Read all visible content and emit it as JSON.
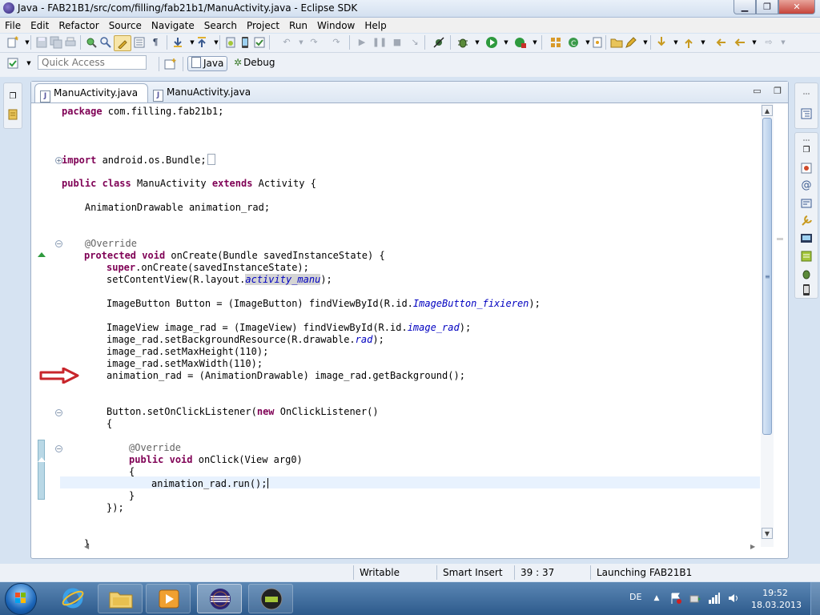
{
  "window": {
    "title": "Java - FAB21B1/src/com/filling/fab21b1/ManuActivity.java - Eclipse SDK",
    "controls": {
      "minimize": "▁",
      "maximize": "❐",
      "close": "✕"
    }
  },
  "menu": [
    "File",
    "Edit",
    "Refactor",
    "Source",
    "Navigate",
    "Search",
    "Project",
    "Run",
    "Window",
    "Help"
  ],
  "toolbar": {
    "quick_access_placeholder": "Quick Access",
    "perspectives": [
      {
        "label": "Java",
        "icon": "java-perspective-icon",
        "selected": true
      },
      {
        "label": "Debug",
        "icon": "bug-icon",
        "selected": false
      }
    ]
  },
  "editor": {
    "tabs": [
      {
        "label": "ManuActivity.java",
        "active": true,
        "close": "✕"
      },
      {
        "label": "ManuActivity.java",
        "active": false
      }
    ],
    "code": {
      "l1_kw": "package",
      "l1_rest": " com.filling.fab21b1;",
      "l2_kw": "import",
      "l2_rest": " android.os.Bundle;",
      "l3_kw1": "public",
      "l3_kw2": "class",
      "l3_mid": " ManuActivity ",
      "l3_kw3": "extends",
      "l3_rest": " Activity {",
      "l4": "    AnimationDrawable animation_rad;",
      "l5": "    @Override",
      "l6_kw1": "protected",
      "l6_kw2": "void",
      "l6_rest": " onCreate(Bundle savedInstanceState) {",
      "l7_kw": "super",
      "l7_rest": ".onCreate(savedInstanceState);",
      "l8_pre": "setContentView(R.layout.",
      "l8_field": "activity_manu",
      "l8_post": ");",
      "l9_pre": "ImageButton Button = (ImageButton) findViewById(R.id.",
      "l9_field": "ImageButton_fixieren",
      "l9_post": ");",
      "l10_pre": "ImageView image_rad = (ImageView) findViewById(R.id.",
      "l10_field": "image_rad",
      "l10_post": ");",
      "l11_pre": "image_rad.setBackgroundResource(R.drawable.",
      "l11_field": "rad",
      "l11_post": ");",
      "l12": "image_rad.setMaxHeight(110);",
      "l13": "image_rad.setMaxWidth(110);",
      "l14": "animation_rad = (AnimationDrawable) image_rad.getBackground();",
      "l15_pre": "Button.setOnClickListener(",
      "l15_kw": "new",
      "l15_post": " OnClickListener()",
      "l16": "{",
      "l17": "@Override",
      "l18_kw1": "public",
      "l18_kw2": "void",
      "l18_rest": " onClick(View arg0)",
      "l19": "{",
      "l20": "animation_rad.run();",
      "l21": "}",
      "l22": "});",
      "l23": "}"
    },
    "fold_marks": {
      "expanded": "−",
      "collapsed": "+"
    }
  },
  "status": {
    "mode": "Writable",
    "insert": "Smart Insert",
    "position": "39 : 37",
    "progress": "Launching FAB21B1"
  },
  "taskbar": {
    "language": "DE",
    "time": "19:52",
    "date": "18.03.2013",
    "apps": [
      {
        "name": "internet-explorer-icon"
      },
      {
        "name": "explorer-folder-icon"
      },
      {
        "name": "media-player-icon"
      },
      {
        "name": "eclipse-icon",
        "active": true
      },
      {
        "name": "android-emulator-icon"
      }
    ]
  },
  "colors": {
    "keyword": "#7f0055",
    "annotation": "#646464",
    "field": "#0000c0",
    "current_line": "#e8f2fe",
    "arrow": "#c8252b"
  }
}
